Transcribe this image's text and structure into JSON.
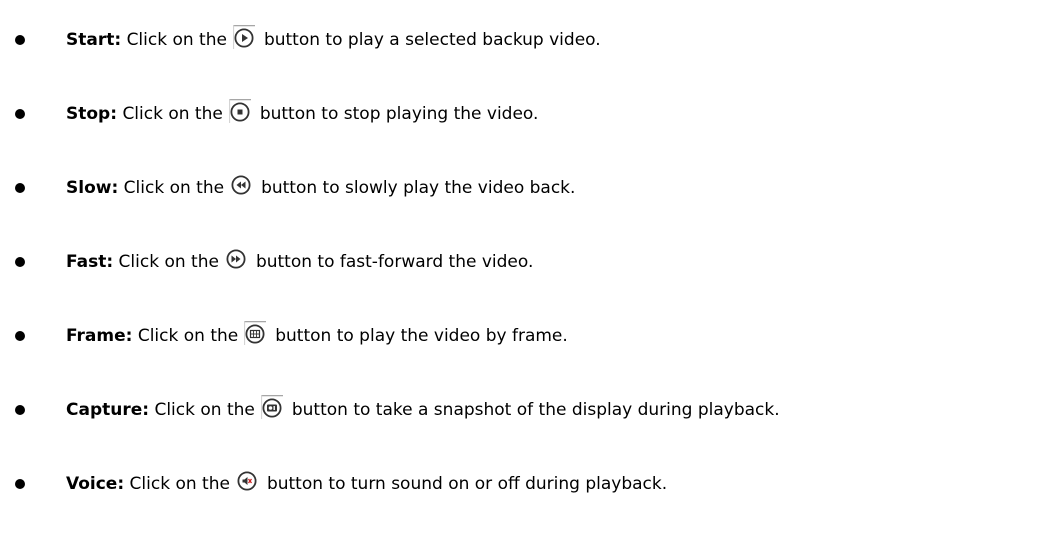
{
  "items": [
    {
      "term": "Start:",
      "before": "Click on the",
      "after": "button to play a selected backup video.",
      "icon": "play-icon"
    },
    {
      "term": "Stop:",
      "before": "Click on the",
      "after": "button to stop playing the video.",
      "icon": "stop-icon"
    },
    {
      "term": "Slow:",
      "before": "Click on the",
      "after": "button to slowly play the video back.",
      "icon": "slow-rewind-icon"
    },
    {
      "term": "Fast:",
      "before": "Click on the",
      "after": "button to fast-forward the video.",
      "icon": "fast-forward-icon"
    },
    {
      "term": "Frame:",
      "before": "Click on the",
      "after": "button to play the video by frame.",
      "icon": "frame-icon"
    },
    {
      "term": "Capture:",
      "before": "Click on the",
      "after": "button to take a snapshot of the display during playback.",
      "icon": "capture-icon"
    },
    {
      "term": "Voice:",
      "before": "Click on the",
      "after": "button to turn sound on or off during playback.",
      "icon": "voice-icon"
    }
  ]
}
